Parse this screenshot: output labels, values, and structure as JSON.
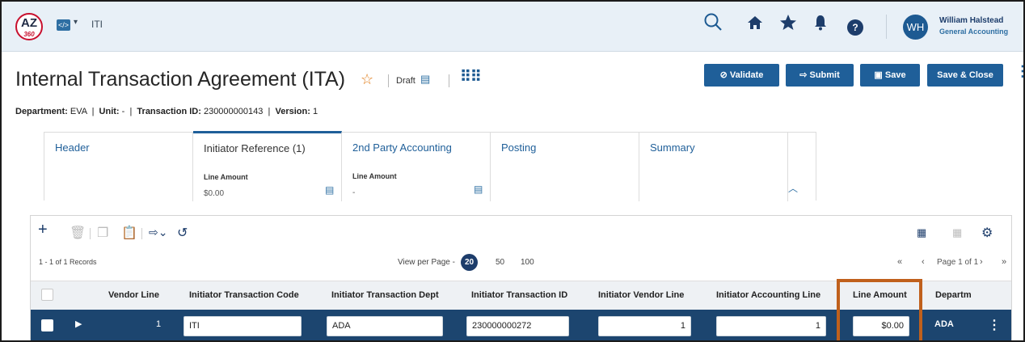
{
  "topbar": {
    "logo_text": "AZ",
    "logo_sub": "360",
    "app_icon": "code-window-icon",
    "app_caret": "▾",
    "app_title": "ITI",
    "icons": [
      "search-icon",
      "home-icon",
      "star-icon",
      "bell-icon",
      "help-icon"
    ],
    "help_label": "?",
    "user_initials": "WH",
    "user_name": "William Halstead",
    "user_role": "General Accounting"
  },
  "page": {
    "title": "Internal Transaction Agreement (ITA)",
    "status": "Draft",
    "buttons": {
      "validate": "Validate",
      "submit": "Submit",
      "save": "Save",
      "save_close": "Save & Close"
    },
    "meta": {
      "department_label": "Department:",
      "department": "EVA",
      "unit_label": "Unit:",
      "unit": "-",
      "transaction_id_label": "Transaction ID:",
      "transaction_id": "230000000143",
      "version_label": "Version:",
      "version": "1"
    }
  },
  "tabs": [
    {
      "label": "Header"
    },
    {
      "label": "Initiator Reference (1)",
      "sub_label": "Line Amount",
      "sub_value": "$0.00",
      "active": true
    },
    {
      "label": "2nd Party Accounting",
      "sub_label": "Line Amount",
      "sub_value": "-"
    },
    {
      "label": "Posting"
    },
    {
      "label": "Summary"
    }
  ],
  "grid": {
    "records": "1 - 1 of 1 Records",
    "view_per_page_label": "View per Page -",
    "page_sizes": [
      "20",
      "50",
      "100"
    ],
    "selected_page_size": "20",
    "page_info": "Page 1 of 1",
    "columns": [
      "Vendor Line",
      "Initiator Transaction Code",
      "Initiator Transaction Dept",
      "Initiator Transaction ID",
      "Initiator Vendor Line",
      "Initiator Accounting Line",
      "Line Amount",
      "Departm"
    ],
    "row": {
      "vendor_line": "1",
      "transaction_code": "ITI",
      "transaction_dept": "ADA",
      "transaction_id": "230000000272",
      "vendor_line_value": "1",
      "accounting_line": "1",
      "line_amount": "$0.00",
      "department": "ADA"
    }
  },
  "colors": {
    "primary": "#1f5f99",
    "navy": "#1d3d6b",
    "row_bg": "#1c456f",
    "highlight": "#c0601c",
    "star": "#e07b16"
  }
}
